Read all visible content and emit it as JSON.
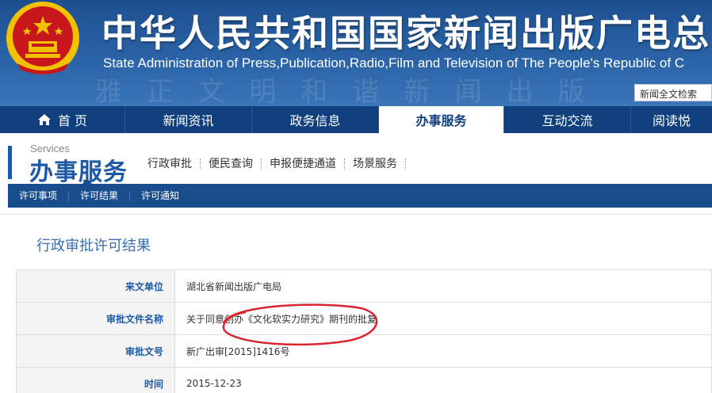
{
  "header": {
    "title_cn": "中华人民共和国国家新闻出版广电总",
    "title_en": "State Administration of Press,Publication,Radio,Film and Television of The People's Republic of C",
    "search_placeholder": "新闻全文检索"
  },
  "mainnav": {
    "items": [
      "首 页",
      "新闻资讯",
      "政务信息",
      "办事服务",
      "互动交流",
      "阅读悦"
    ],
    "active": "办事服务"
  },
  "section": {
    "services_en": "Services",
    "services_cn": "办事服务",
    "subnav": [
      "行政审批",
      "便民查询",
      "申报便捷通道",
      "场景服务"
    ],
    "bluebar": [
      "许可事项",
      "许可结果",
      "许可通知"
    ]
  },
  "page": {
    "title": "行政审批许可结果",
    "rows": [
      {
        "label": "来文单位",
        "value": "湖北省新闻出版广电局"
      },
      {
        "label": "审批文件名称",
        "value": "关于同意创办《文化软实力研究》期刊的批复"
      },
      {
        "label": "审批文号",
        "value": "新广出审[2015]1416号"
      },
      {
        "label": "时间",
        "value": "2015-12-23"
      }
    ]
  },
  "colors": {
    "header_blue": "#2a63a6",
    "nav_blue": "#0f3f7c",
    "accent_blue": "#1d5aa6",
    "annotation_red": "#d8252f",
    "emblem_red": "#c8161d",
    "emblem_gold": "#f2c200"
  }
}
